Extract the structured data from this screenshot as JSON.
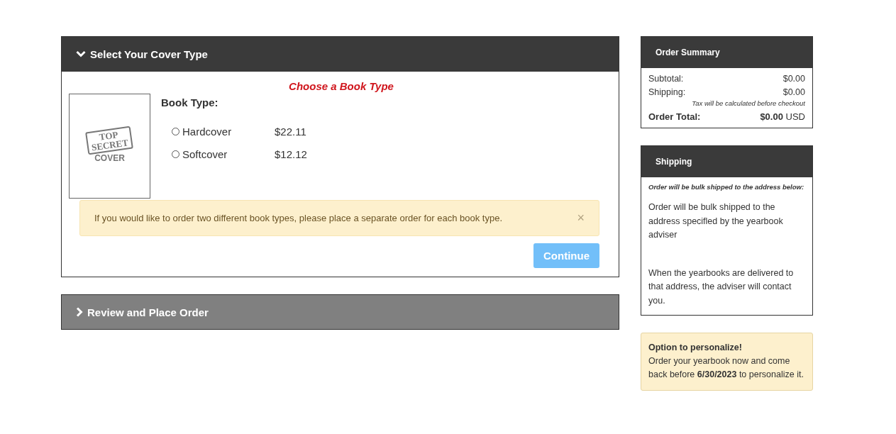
{
  "sections": [
    {
      "title": "Select Your Cover Type",
      "expanded": true
    },
    {
      "title": "Review and Place Order",
      "expanded": false
    }
  ],
  "cover_step": {
    "heading": "Choose a Book Type",
    "cover_image": {
      "stamp_top": "TOP",
      "stamp_middle": "SECRET",
      "caption": "COVER"
    },
    "label": "Book Type:",
    "options": [
      {
        "name": "Hardcover",
        "price": "$22.11",
        "selected": false
      },
      {
        "name": "Softcover",
        "price": "$12.12",
        "selected": false
      }
    ],
    "alert": {
      "text": "If you would like to order two different book types, please place a separate order for each book type.",
      "close": "×"
    },
    "continue_button": {
      "label": "Continue",
      "disabled": true
    }
  },
  "order_summary": {
    "title": "Order Summary",
    "rows": [
      {
        "label": "Subtotal:",
        "value": "$0.00"
      },
      {
        "label": "Shipping:",
        "value": "$0.00"
      }
    ],
    "tax_note": "Tax will be calculated before checkout",
    "total_label": "Order Total:",
    "total_value": "**$0.00** USD"
  },
  "shipping": {
    "title": "Shipping",
    "note": "Order will be bulk shipped to the address below:",
    "paragraphs": [
      "Order will be bulk shipped to the address specifled by the yearbook adviser",
      "When the yearbooks are delivered to that address, the adviser will contact you."
    ]
  },
  "personalize": {
    "title": "Option to personalize!",
    "text": "Order your yearbook now and come back before **6/30/2023** to personalize it."
  }
}
